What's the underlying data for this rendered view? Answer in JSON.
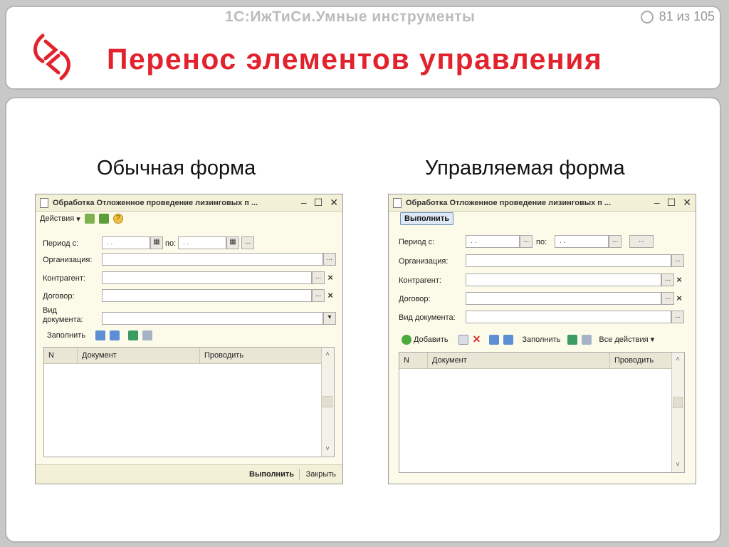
{
  "header": {
    "brand": "1С:ИжТиСи.Умные инструменты",
    "pager": "81 из 105",
    "title": "Перенос элементов управления"
  },
  "colors": {
    "accent": "#e2232e",
    "frame": "#b4b4b4"
  },
  "captions": {
    "left": "Обычная форма",
    "right": "Управляемая форма"
  },
  "left_form": {
    "title": "Обработка  Отложенное проведение лизинговых п ...",
    "toolbar": {
      "actions": "Действия"
    },
    "labels": {
      "period_from": "Период с:",
      "period_to": "по:",
      "org": "Организация:",
      "contractor": "Контрагент:",
      "contract": "Договор:",
      "doc_type_1": "Вид",
      "doc_type_2": "документа:"
    },
    "date_placeholder": ". .",
    "dots": "...",
    "fill": "Заполнить",
    "columns": [
      "N",
      "Документ",
      "Проводить"
    ],
    "footer": {
      "execute": "Выполнить",
      "close": "Закрыть"
    }
  },
  "right_form": {
    "title": "Обработка  Отложенное проведение лизинговых п ...",
    "execute": "Выполнить",
    "labels": {
      "period_from": "Период с:",
      "period_to": "по:",
      "org": "Организация:",
      "contractor": "Контрагент:",
      "contract": "Договор:",
      "doc_type": "Вид документа:"
    },
    "date_placeholder": ". .",
    "dots": "...",
    "toolbar": {
      "add": "Добавить",
      "fill": "Заполнить",
      "all_actions": "Все действия"
    },
    "columns": [
      "N",
      "Документ",
      "Проводить"
    ]
  }
}
